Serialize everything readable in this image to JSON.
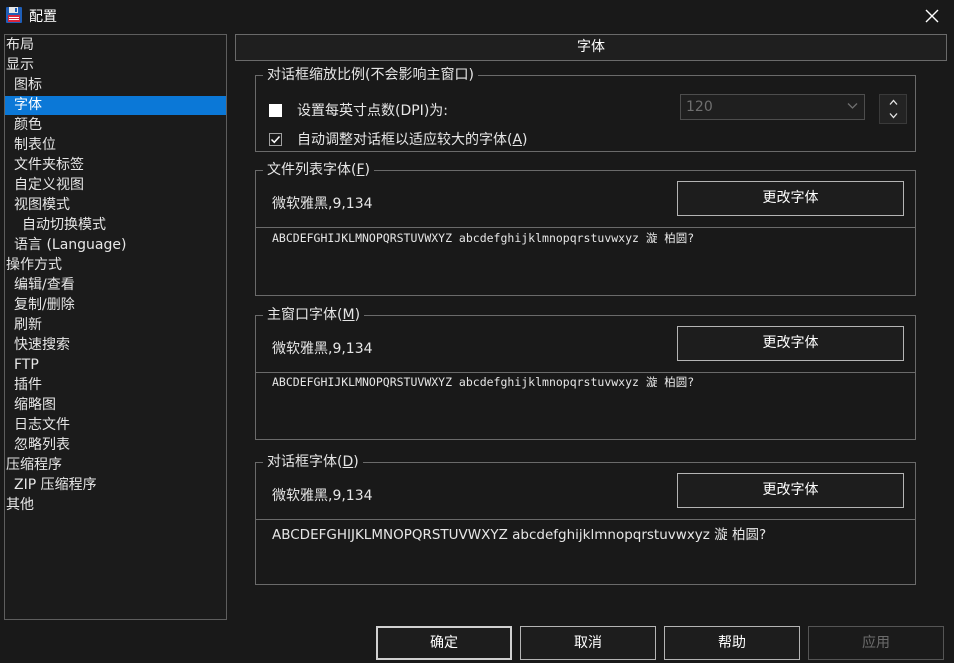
{
  "window": {
    "title": "配置"
  },
  "sidebar": {
    "items": [
      {
        "label": "布局",
        "indent": 0
      },
      {
        "label": "显示",
        "indent": 0
      },
      {
        "label": "图标",
        "indent": 1
      },
      {
        "label": "字体",
        "indent": 1,
        "selected": true
      },
      {
        "label": "颜色",
        "indent": 1
      },
      {
        "label": "制表位",
        "indent": 1
      },
      {
        "label": "文件夹标签",
        "indent": 1
      },
      {
        "label": "自定义视图",
        "indent": 1
      },
      {
        "label": "视图模式",
        "indent": 1
      },
      {
        "label": "自动切换模式",
        "indent": 2
      },
      {
        "label": "语言 (Language)",
        "indent": 1
      },
      {
        "label": "操作方式",
        "indent": 0
      },
      {
        "label": "编辑/查看",
        "indent": 1
      },
      {
        "label": "复制/删除",
        "indent": 1
      },
      {
        "label": "刷新",
        "indent": 1
      },
      {
        "label": "快速搜索",
        "indent": 1
      },
      {
        "label": "FTP",
        "indent": 1
      },
      {
        "label": "插件",
        "indent": 1
      },
      {
        "label": "缩略图",
        "indent": 1
      },
      {
        "label": "日志文件",
        "indent": 1
      },
      {
        "label": "忽略列表",
        "indent": 1
      },
      {
        "label": "压缩程序",
        "indent": 0
      },
      {
        "label": "ZIP 压缩程序",
        "indent": 1
      },
      {
        "label": "其他",
        "indent": 0
      }
    ]
  },
  "panel": {
    "header": "字体",
    "dpi_group": {
      "label": "对话框缩放比例(不会影响主窗口)",
      "dpi_checkbox": {
        "label": "设置每英寸点数(DPI)为:",
        "checked": false
      },
      "dpi_value": "120",
      "auto_checkbox": {
        "label_prefix": "自动调整对话框以适应较大的字体(",
        "label_key": "A",
        "label_suffix": ")",
        "checked": true
      }
    },
    "font_groups": [
      {
        "label_prefix": "文件列表字体(",
        "label_key": "F",
        "label_suffix": ")",
        "font": "微软雅黑,9,134",
        "button": "更改字体",
        "preview": "ABCDEFGHIJKLMNOPQRSTUVWXYZ abcdefghijklmnopqrstuvwxyz 漩  柏圆?"
      },
      {
        "label_prefix": "主窗口字体(",
        "label_key": "M",
        "label_suffix": ")",
        "font": "微软雅黑,9,134",
        "button": "更改字体",
        "preview": "ABCDEFGHIJKLMNOPQRSTUVWXYZ abcdefghijklmnopqrstuvwxyz 漩  柏圆?"
      },
      {
        "label_prefix": "对话框字体(",
        "label_key": "D",
        "label_suffix": ")",
        "font": "微软雅黑,9,134",
        "button": "更改字体",
        "preview": "ABCDEFGHIJKLMNOPQRSTUVWXYZ abcdefghijklmnopqrstuvwxyz 漩  柏圆?"
      }
    ]
  },
  "footer": {
    "ok": "确定",
    "cancel": "取消",
    "help": "帮助",
    "apply": "应用"
  },
  "icons": {
    "app": "floppy-disk-icon",
    "close": "close-icon",
    "dropdown": "chevron-down-icon",
    "spin_up": "chevron-up-icon",
    "spin_down": "chevron-down-icon",
    "check": "checkmark-icon"
  },
  "colors": {
    "selection": "#0b78d7",
    "background": "#191919",
    "border": "#6a6a6a"
  }
}
